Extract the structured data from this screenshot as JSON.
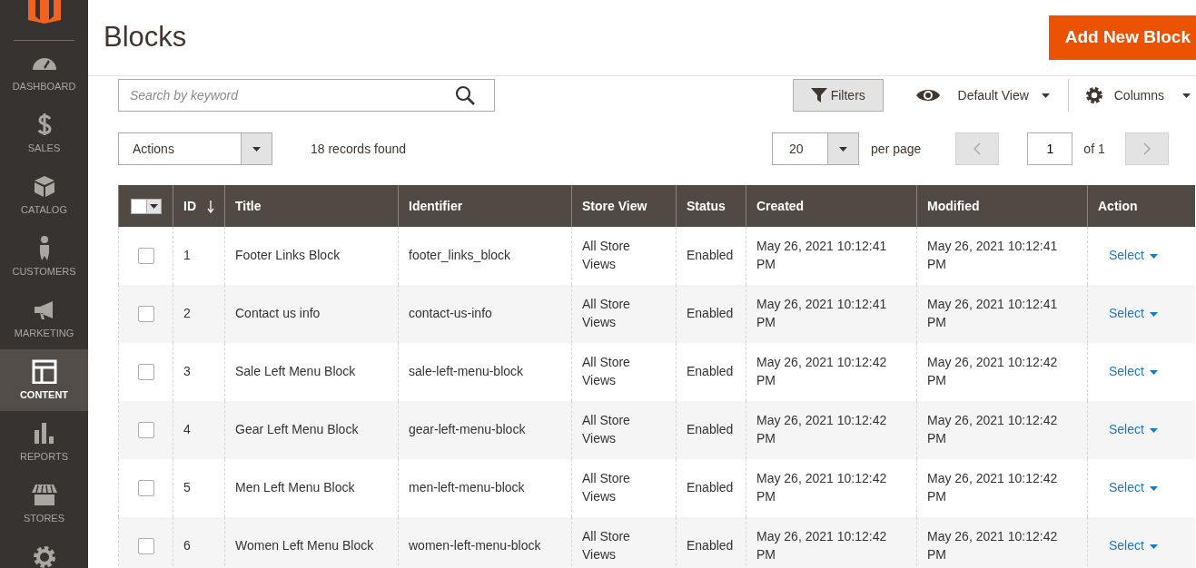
{
  "sidebar": {
    "items": [
      {
        "label": "DASHBOARD",
        "selected": false
      },
      {
        "label": "SALES",
        "selected": false
      },
      {
        "label": "CATALOG",
        "selected": false
      },
      {
        "label": "CUSTOMERS",
        "selected": false
      },
      {
        "label": "MARKETING",
        "selected": false
      },
      {
        "label": "CONTENT",
        "selected": true
      },
      {
        "label": "REPORTS",
        "selected": false
      },
      {
        "label": "STORES",
        "selected": false
      },
      {
        "selected": false
      }
    ]
  },
  "page_title": "Blocks",
  "add_button": "Add New Block",
  "search": {
    "placeholder": "Search by keyword"
  },
  "toolbar": {
    "filters": "Filters",
    "view": "Default View",
    "columns": "Columns"
  },
  "actions": {
    "label": "Actions"
  },
  "records": "18 records found",
  "pagination": {
    "per_page_value": "20",
    "per_page_label": "per page",
    "page": "1",
    "of": "of 1"
  },
  "table": {
    "mass_select": {
      "checked": false
    },
    "columns": [
      {
        "label": "ID",
        "sorted": true
      },
      {
        "label": "Title",
        "sorted": false
      },
      {
        "label": "Identifier",
        "sorted": false
      },
      {
        "label": "Store View",
        "sorted": false
      },
      {
        "label": "Status",
        "sorted": false
      },
      {
        "label": "Created",
        "sorted": false
      },
      {
        "label": "Modified",
        "sorted": false
      },
      {
        "label": "Action",
        "sorted": false
      }
    ],
    "rows": [
      {
        "checked": false,
        "cells": [
          "1",
          "Footer Links Block",
          "footer_links_block",
          "All Store Views",
          "Enabled",
          "May 26, 2021 10:12:41 PM",
          "May 26, 2021 10:12:41 PM"
        ],
        "action": "Select"
      },
      {
        "checked": false,
        "cells": [
          "2",
          "Contact us info",
          "contact-us-info",
          "All Store Views",
          "Enabled",
          "May 26, 2021 10:12:41 PM",
          "May 26, 2021 10:12:41 PM"
        ],
        "action": "Select"
      },
      {
        "checked": false,
        "cells": [
          "3",
          "Sale Left Menu Block",
          "sale-left-menu-block",
          "All Store Views",
          "Enabled",
          "May 26, 2021 10:12:42 PM",
          "May 26, 2021 10:12:42 PM"
        ],
        "action": "Select"
      },
      {
        "checked": false,
        "cells": [
          "4",
          "Gear Left Menu Block",
          "gear-left-menu-block",
          "All Store Views",
          "Enabled",
          "May 26, 2021 10:12:42 PM",
          "May 26, 2021 10:12:42 PM"
        ],
        "action": "Select"
      },
      {
        "checked": false,
        "cells": [
          "5",
          "Men Left Menu Block",
          "men-left-menu-block",
          "All Store Views",
          "Enabled",
          "May 26, 2021 10:12:42 PM",
          "May 26, 2021 10:12:42 PM"
        ],
        "action": "Select"
      },
      {
        "checked": false,
        "cells": [
          "6",
          "Women Left Menu Block",
          "women-left-menu-block",
          "All Store Views",
          "Enabled",
          "May 26, 2021 10:12:42 PM",
          "May 26, 2021 10:12:42 PM"
        ],
        "action": "Select"
      }
    ]
  }
}
